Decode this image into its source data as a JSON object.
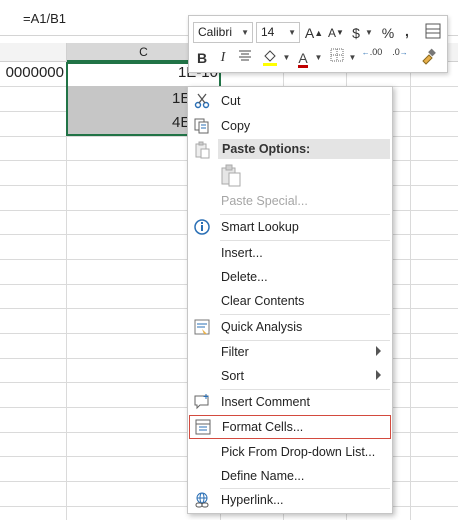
{
  "formula_bar": {
    "text": "=A1/B1"
  },
  "columns": {
    "c_label": "C"
  },
  "cells": {
    "b1": "0000000",
    "c1": "1E-10",
    "c2": "1E",
    "c3": "4E"
  },
  "mini_toolbar": {
    "font_name": "Calibri",
    "font_size": "14",
    "grow_font": "A",
    "shrink_font": "A",
    "currency": "$",
    "percent": "%",
    "comma": ",",
    "bold": "B",
    "italic": "I",
    "font_color_label": "A",
    "dec_increase": ".00",
    "dec_decrease": ".0"
  },
  "context_menu": {
    "cut": "Cut",
    "copy": "Copy",
    "paste_options": "Paste Options:",
    "paste_special": "Paste Special...",
    "smart_lookup": "Smart Lookup",
    "insert": "Insert...",
    "delete": "Delete...",
    "clear_contents": "Clear Contents",
    "quick_analysis": "Quick Analysis",
    "filter": "Filter",
    "sort": "Sort",
    "insert_comment": "Insert Comment",
    "format_cells": "Format Cells...",
    "pick_from_list": "Pick From Drop-down List...",
    "define_name": "Define Name...",
    "hyperlink": "Hyperlink..."
  },
  "colors": {
    "selection_border": "#217346",
    "highlight_border": "#d34a3e",
    "font_color": "#c00000",
    "highlight_color": "#ffff00"
  }
}
